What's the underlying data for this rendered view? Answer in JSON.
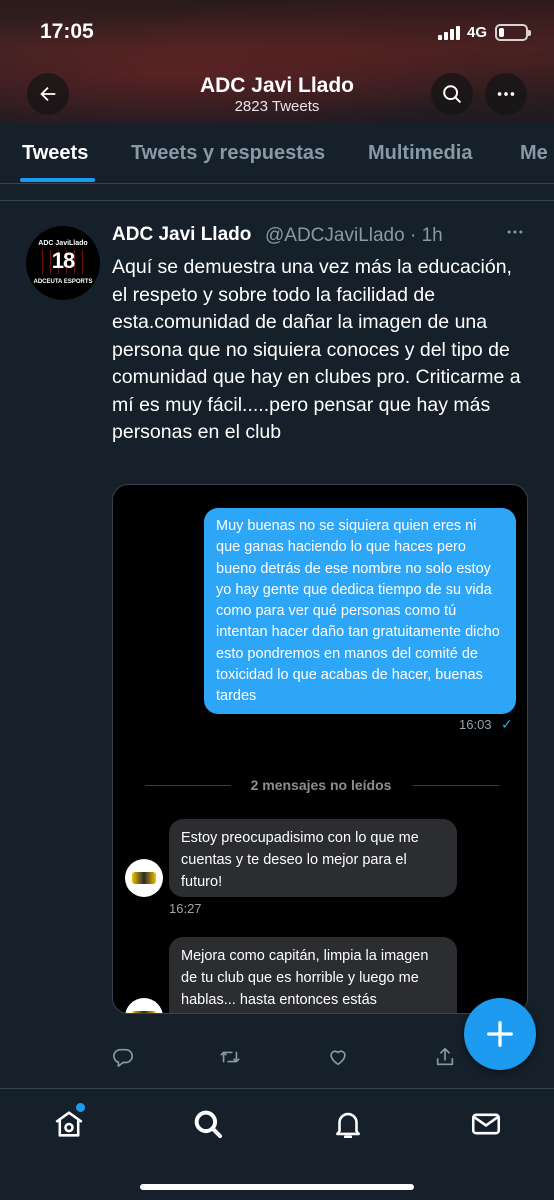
{
  "status_bar": {
    "time": "17:05",
    "network": "4G"
  },
  "header": {
    "title": "ADC Javi Llado",
    "subtitle": "2823 Tweets"
  },
  "tabs": [
    {
      "label": "Tweets",
      "active": true
    },
    {
      "label": "Tweets y respuestas"
    },
    {
      "label": "Multimedia"
    },
    {
      "label": "Me"
    }
  ],
  "tweet": {
    "author_name": "ADC Javi Llado",
    "handle_time": "@ADCJaviLlado · 1h",
    "avatar": {
      "top_text": "ADC JaviLlado",
      "number": "18",
      "bottom_text": "ADCEUTA ESPORTS"
    },
    "text": "Aquí se demuestra una vez más la educación, el respeto y sobre todo la facilidad de esta.comunidad de dañar la imagen de una persona que no siquiera conoces y del tipo de comunidad que hay en clubes pro. Criticarme a mí es muy fácil.....pero pensar que hay más personas en el club",
    "media": {
      "outgoing_message": "Muy buenas no se siquiera quien eres ni que ganas haciendo lo que haces pero bueno detrás de ese nombre no solo estoy yo hay gente que dedica tiempo de su vida como para ver qué personas como tú intentan hacer daño tan gratuitamente dicho esto pondremos en manos del comité de toxicidad lo que acabas de hacer, buenas tardes",
      "outgoing_time": "16:03",
      "unread_label": "2 mensajes no leídos",
      "incoming": [
        {
          "text": "Estoy preocupadisimo con lo que me cuentas y te deseo lo mejor para el futuro!",
          "time": "16:27"
        },
        {
          "text": "Mejora como capitán, limpia la imagen de tu club que es horrible y luego me hablas... hasta entonces estás bloqueado, felices fiestas :)"
        }
      ]
    }
  },
  "icons": {
    "back": "arrow-left-icon",
    "search": "search-icon",
    "more": "more-icon",
    "reply": "reply-icon",
    "retweet": "retweet-icon",
    "like": "heart-icon",
    "share": "share-icon",
    "compose": "plus-icon",
    "home": "home-icon",
    "explore": "search-icon",
    "notifications": "bell-icon",
    "messages": "mail-icon"
  },
  "colors": {
    "accent": "#1d9bf0",
    "background": "#15202b",
    "muted": "#8899a6"
  }
}
